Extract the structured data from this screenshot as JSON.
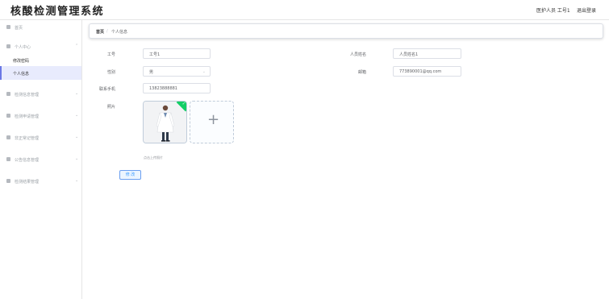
{
  "header": {
    "app_title": "核酸检测管理系统",
    "user_info": "医护人员 工号1",
    "logout_label": "退出登录"
  },
  "sidebar": {
    "items": [
      {
        "label": "首页",
        "icon": "home-icon"
      },
      {
        "label": "个人中心",
        "icon": "user-icon",
        "expanded": true,
        "children": [
          {
            "label": "修改密码",
            "active": false
          },
          {
            "label": "个人信息",
            "active": true
          }
        ]
      },
      {
        "label": "检测信息管理",
        "icon": "user-icon"
      },
      {
        "label": "检测申请管理",
        "icon": "file-icon"
      },
      {
        "label": "非正常记管理",
        "icon": "list-icon"
      },
      {
        "label": "公告信息管理",
        "icon": "bell-icon"
      },
      {
        "label": "检测结果管理",
        "icon": "list-icon"
      }
    ]
  },
  "breadcrumb": {
    "home": "首页",
    "separator": "/",
    "current": "个人信息"
  },
  "form": {
    "employee_id": {
      "label": "工号",
      "value": "工号1"
    },
    "staff_name": {
      "label": "人员姓名",
      "value": "人员姓名1"
    },
    "gender": {
      "label": "性别",
      "value": "男"
    },
    "email": {
      "label": "邮箱",
      "value": "773890001@qq.com"
    },
    "phone": {
      "label": "联系手机",
      "value": "13823888881"
    },
    "photo": {
      "label": "照片",
      "hint": "点击上传照片"
    },
    "submit_label": "修 改"
  },
  "colors": {
    "accent": "#6b78e5",
    "active_bg": "#e8ebfd",
    "success_badge": "#13ce66",
    "button_text": "#409eff"
  }
}
